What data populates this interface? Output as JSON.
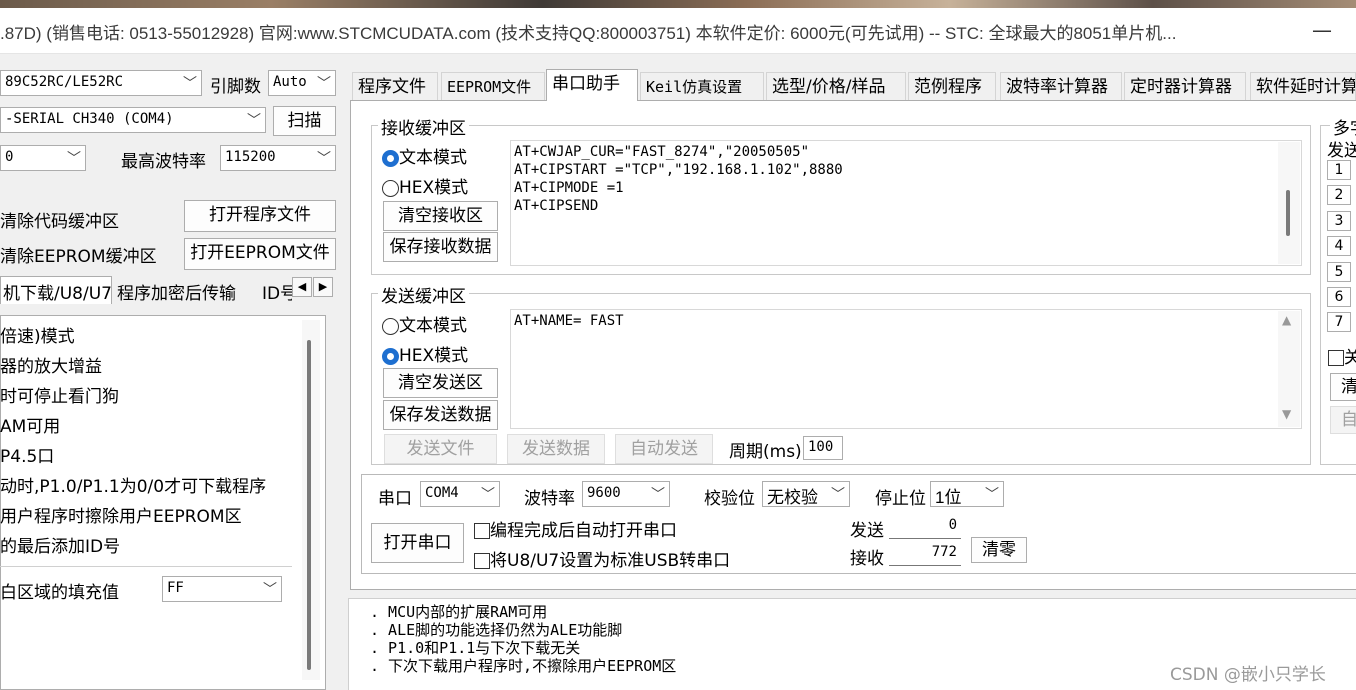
{
  "window": {
    "title": ".87D) (销售电话: 0513-55012928) 官网:www.STCMCUDATA.com  (技术支持QQ:800003751) 本软件定价: 6000元(可先试用) -- STC: 全球最大的8051单片机...",
    "minimize": "—"
  },
  "left": {
    "mcu_type": "89C52RC/LE52RC",
    "pin_label": "引脚数",
    "pin_value": "Auto",
    "port_value": "-SERIAL CH340 (COM4)",
    "scan_button": "扫描",
    "min_baud_value": "0",
    "max_baud_label": "最高波特率",
    "max_baud_value": "115200",
    "clear_code_label": "清除代码缓冲区",
    "open_program_button": "打开程序文件",
    "clear_eeprom_label": "清除EEPROM缓冲区",
    "open_eeprom_button": "打开EEPROM文件",
    "tabs": [
      "机下载/U8/U7",
      "程序加密后传输",
      "ID号"
    ],
    "options": [
      "倍速)模式",
      "器的放大增益",
      "时可停止看门狗",
      "AM可用",
      "P4.5口",
      "动时,P1.0/P1.1为0/0才可下载程序",
      "用户程序时擦除用户EEPROM区",
      "的最后添加ID号"
    ],
    "fill_label": "白区域的填充值",
    "fill_value": "FF"
  },
  "tabs": [
    "程序文件",
    "EEPROM文件",
    "串口助手",
    "Keil仿真设置",
    "选型/价格/样品",
    "范例程序",
    "波特率计算器",
    "定时器计算器",
    "软件延时计算"
  ],
  "receive": {
    "group_title": "接收缓冲区",
    "text_mode": "文本模式",
    "hex_mode": "HEX模式",
    "clear_button": "清空接收区",
    "save_button": "保存接收数据",
    "content": "AT+CWJAP_CUR=\"FAST_8274\",\"20050505\"\nAT+CIPSTART =\"TCP\",\"192.168.1.102\",8880\nAT+CIPMODE =1\nAT+CIPSEND"
  },
  "send": {
    "group_title": "发送缓冲区",
    "text_mode": "文本模式",
    "hex_mode": "HEX模式",
    "clear_button": "清空发送区",
    "save_button": "保存发送数据",
    "content": "AT+NAME= FAST",
    "send_file": "发送文件",
    "send_data": "发送数据",
    "auto_send": "自动发送",
    "period_label": "周期(ms)",
    "period_value": "100"
  },
  "serial": {
    "port_label": "串口",
    "port_value": "COM4",
    "baud_label": "波特率",
    "baud_value": "9600",
    "parity_label": "校验位",
    "parity_value": "无校验",
    "stop_label": "停止位",
    "stop_value": "1位",
    "open_button": "打开串口",
    "auto_open_label": "编程完成后自动打开串口",
    "usb_label": "将U8/U7设置为标准USB转串口",
    "send_label": "发送",
    "send_count": "0",
    "recv_label": "接收",
    "recv_count": "772",
    "clear_button": "清零"
  },
  "right_panel": {
    "title_partial": "多字",
    "send_partial": "发送",
    "numbers": [
      "1",
      "2",
      "3",
      "4",
      "5",
      "6",
      "7"
    ],
    "check_partial": "关",
    "btn1_partial": "清",
    "btn2_partial": "自"
  },
  "log": [
    ". MCU内部的扩展RAM可用",
    ". ALE脚的功能选择仍然为ALE功能脚",
    ". P1.0和P1.1与下次下载无关",
    ". 下次下载用户程序时,不擦除用户EEPROM区"
  ],
  "watermark": "CSDN @嵌小只学长"
}
